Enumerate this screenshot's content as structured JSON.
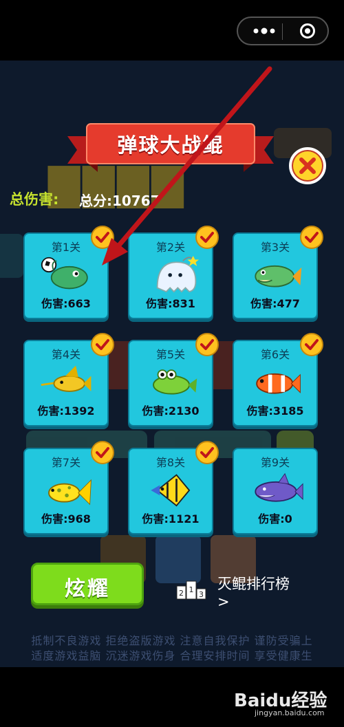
{
  "background": {
    "footer_lines": [
      "抵制不良游戏  拒绝盗版游戏  注意自我保护  谨防受骗上",
      "适度游戏益脑  沉迷游戏伤身  合理安排时间  享受健康生"
    ]
  },
  "popup": {
    "banner_title": "弹球大战鲲",
    "total_damage_label": "总伤害:",
    "total_score_label": "总分:10767",
    "levels": [
      {
        "label": "第1关",
        "damage": "伤害:663",
        "completed": true,
        "fish": "anglerfish-with-ball"
      },
      {
        "label": "第2关",
        "damage": "伤害:831",
        "completed": true,
        "fish": "ghost-fish"
      },
      {
        "label": "第3关",
        "damage": "伤害:477",
        "completed": true,
        "fish": "green-fish"
      },
      {
        "label": "第4关",
        "damage": "伤害:1392",
        "completed": true,
        "fish": "swordfish"
      },
      {
        "label": "第5关",
        "damage": "伤害:2130",
        "completed": true,
        "fish": "frog-fish"
      },
      {
        "label": "第6关",
        "damage": "伤害:3185",
        "completed": true,
        "fish": "clownfish"
      },
      {
        "label": "第7关",
        "damage": "伤害:968",
        "completed": true,
        "fish": "spotted-fish"
      },
      {
        "label": "第8关",
        "damage": "伤害:1121",
        "completed": true,
        "fish": "angelfish"
      },
      {
        "label": "第9关",
        "damage": "伤害:0",
        "completed": false,
        "fish": "purple-shark"
      }
    ],
    "show_button": "炫耀",
    "rank_link_line1": "灭鲲排行榜",
    "rank_link_line2": ">",
    "podium_numbers": [
      "2",
      "1",
      "3"
    ]
  },
  "watermark": {
    "logo": "Baidu经验",
    "url": "jingyan.baidu.com"
  },
  "colors": {
    "card_bg": "#22c7de",
    "check_bg": "#ffc21f",
    "show_button": "#7edc1c",
    "arrow": "#c0151a"
  }
}
